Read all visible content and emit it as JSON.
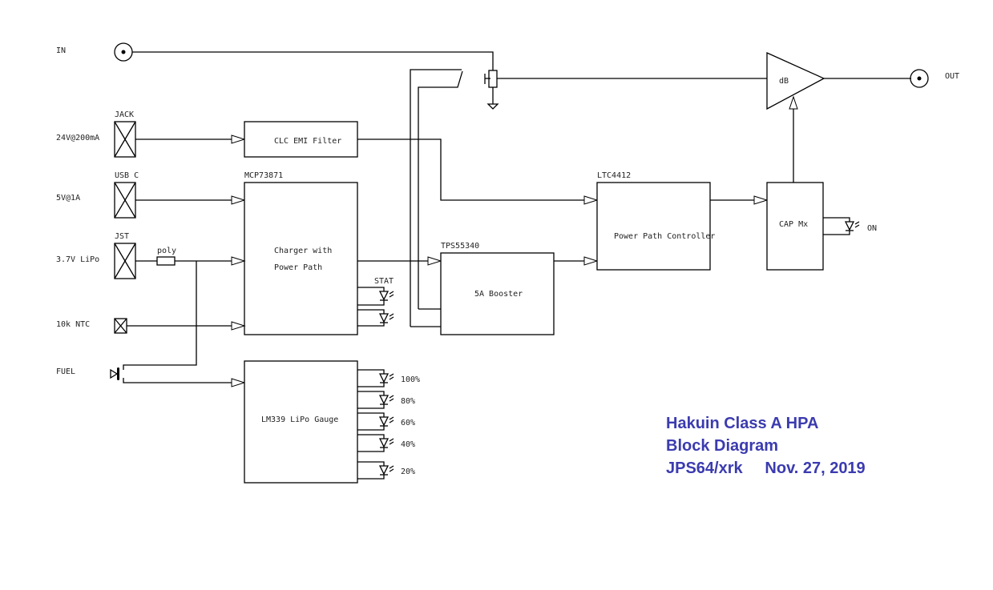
{
  "diagram": {
    "title_lines": [
      "Hakuin Class A HPA",
      "Block Diagram",
      "JPS64/xrk     Nov. 27, 2019"
    ],
    "title_color": "#3b3bb0",
    "inputs": {
      "in": "IN",
      "jack_conn": "JACK",
      "jack_spec": "24V@200mA",
      "usbc_conn": "USB C",
      "usbc_spec": "5V@1A",
      "jst_conn": "JST",
      "jst_spec": "3.7V LiPo",
      "poly": "poly",
      "ntc": "10k NTC",
      "fuel": "FUEL"
    },
    "blocks": {
      "emi": "CLC EMI Filter",
      "charger_part": "MCP73871",
      "charger_line1": "Charger with",
      "charger_line2": "Power Path",
      "stat": "STAT",
      "booster_part": "TPS55340",
      "booster": "5A Booster",
      "ppc_part": "LTC4412",
      "ppc": "Power Path Controller",
      "cap": "CAP Mx",
      "on": "ON",
      "gauge": "LM339 LiPo Gauge",
      "amp": "dB",
      "out": "OUT"
    },
    "gauge_levels": [
      "100%",
      "80%",
      "60%",
      "40%",
      "20%"
    ]
  }
}
